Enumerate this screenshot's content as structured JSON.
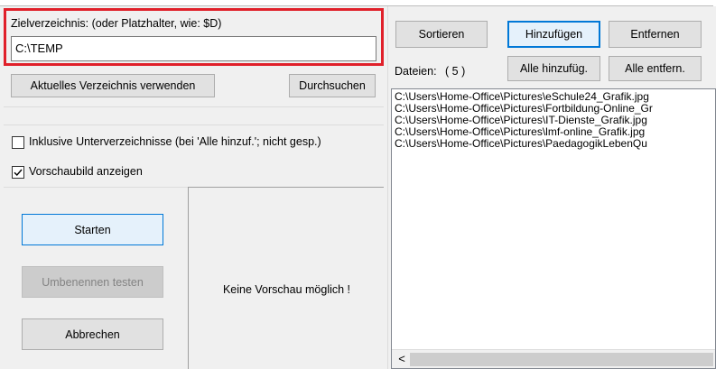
{
  "target": {
    "legend": "Zielverzeichnis: (oder Platzhalter, wie: $D)",
    "value": "C:\\TEMP",
    "use_current_dir_label": "Aktuelles Verzeichnis verwenden",
    "browse_label": "Durchsuchen"
  },
  "options": {
    "include_subdirs_label": "Inklusive Unterverzeichnisse (bei 'Alle hinzuf.'; nicht gesp.)",
    "include_subdirs_checked": false,
    "show_preview_label": "Vorschaubild anzeigen",
    "show_preview_checked": true
  },
  "actions": {
    "start_label": "Starten",
    "test_rename_label": "Umbenennen testen",
    "cancel_label": "Abbrechen"
  },
  "preview": {
    "message": "Keine Vorschau möglich !"
  },
  "files": {
    "sort_label": "Sortieren",
    "add_label": "Hinzufügen",
    "remove_label": "Entfernen",
    "add_all_label": "Alle hinzufüg.",
    "remove_all_label": "Alle entfern.",
    "count_label": "Dateien:",
    "count_value": "( 5 )",
    "items": [
      "C:\\Users\\Home-Office\\Pictures\\eSchule24_Grafik.jpg",
      "C:\\Users\\Home-Office\\Pictures\\Fortbildung-Online_Gr",
      "C:\\Users\\Home-Office\\Pictures\\IT-Dienste_Grafik.jpg",
      "C:\\Users\\Home-Office\\Pictures\\lmf-online_Grafik.jpg",
      "C:\\Users\\Home-Office\\Pictures\\PaedagogikLebenQu"
    ],
    "scroll_left_glyph": "<"
  },
  "colors": {
    "highlight_red": "#e0202a",
    "focus_blue": "#0078d7"
  }
}
